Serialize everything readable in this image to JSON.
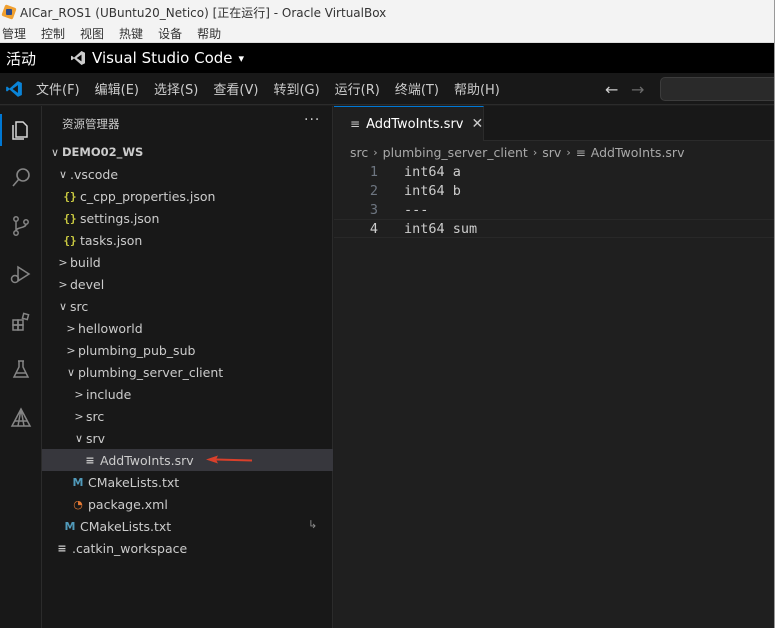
{
  "vbox": {
    "title": "AICar_ROS1 (UBuntu20_Netico) [正在运行] - Oracle VirtualBox",
    "menu": [
      "管理",
      "控制",
      "视图",
      "热键",
      "设备",
      "帮助"
    ]
  },
  "gnome": {
    "activities": "活动",
    "app_name": "Visual Studio Code",
    "app_arrow": "▾"
  },
  "vscode_menu": [
    "文件(F)",
    "编辑(E)",
    "选择(S)",
    "查看(V)",
    "转到(G)",
    "运行(R)",
    "终端(T)",
    "帮助(H)"
  ],
  "nav": {
    "back": "←",
    "forward": "→"
  },
  "explorer": {
    "header": "资源管理器",
    "more": "···",
    "tree": [
      {
        "label": "DEMO02_WS",
        "chevron": "∨",
        "icon": "",
        "icon_type": "none"
      },
      {
        "label": ".vscode",
        "chevron": "∨",
        "icon": "",
        "icon_type": "none"
      },
      {
        "label": "c_cpp_properties.json",
        "chevron": "",
        "icon": "{}",
        "icon_type": "json"
      },
      {
        "label": "settings.json",
        "chevron": "",
        "icon": "{}",
        "icon_type": "json"
      },
      {
        "label": "tasks.json",
        "chevron": "",
        "icon": "{}",
        "icon_type": "json"
      },
      {
        "label": "build",
        "chevron": ">",
        "icon": "",
        "icon_type": "none"
      },
      {
        "label": "devel",
        "chevron": ">",
        "icon": "",
        "icon_type": "none"
      },
      {
        "label": "src",
        "chevron": "∨",
        "icon": "",
        "icon_type": "none"
      },
      {
        "label": "helloworld",
        "chevron": ">",
        "icon": "",
        "icon_type": "none"
      },
      {
        "label": "plumbing_pub_sub",
        "chevron": ">",
        "icon": "",
        "icon_type": "none"
      },
      {
        "label": "plumbing_server_client",
        "chevron": "∨",
        "icon": "",
        "icon_type": "none"
      },
      {
        "label": "include",
        "chevron": ">",
        "icon": "",
        "icon_type": "none"
      },
      {
        "label": "src",
        "chevron": ">",
        "icon": "",
        "icon_type": "none"
      },
      {
        "label": "srv",
        "chevron": "∨",
        "icon": "",
        "icon_type": "none"
      },
      {
        "label": "AddTwoInts.srv",
        "chevron": "",
        "icon": "≡",
        "icon_type": "lines"
      },
      {
        "label": "CMakeLists.txt",
        "chevron": "",
        "icon": "M",
        "icon_type": "cmake"
      },
      {
        "label": "package.xml",
        "chevron": "",
        "icon": "◔",
        "icon_type": "rss"
      },
      {
        "label": "CMakeLists.txt",
        "chevron": "",
        "icon": "M",
        "icon_type": "cmake"
      },
      {
        "label": ".catkin_workspace",
        "chevron": "",
        "icon": "≡",
        "icon_type": "lines"
      }
    ],
    "modified_marker": "↳"
  },
  "editor": {
    "tab": {
      "label": "AddTwoInts.srv",
      "icon": "≡",
      "close": "✕"
    },
    "breadcrumb": [
      "src",
      "plumbing_server_client",
      "srv",
      "AddTwoInts.srv"
    ],
    "breadcrumb_sep": "›",
    "lines": [
      {
        "num": "1",
        "text": "int64 a"
      },
      {
        "num": "2",
        "text": "int64 b"
      },
      {
        "num": "3",
        "text": "---"
      },
      {
        "num": "4",
        "text": "int64 sum"
      }
    ]
  },
  "colors": {
    "accent": "#0078d4",
    "arrow": "#d9402b"
  }
}
